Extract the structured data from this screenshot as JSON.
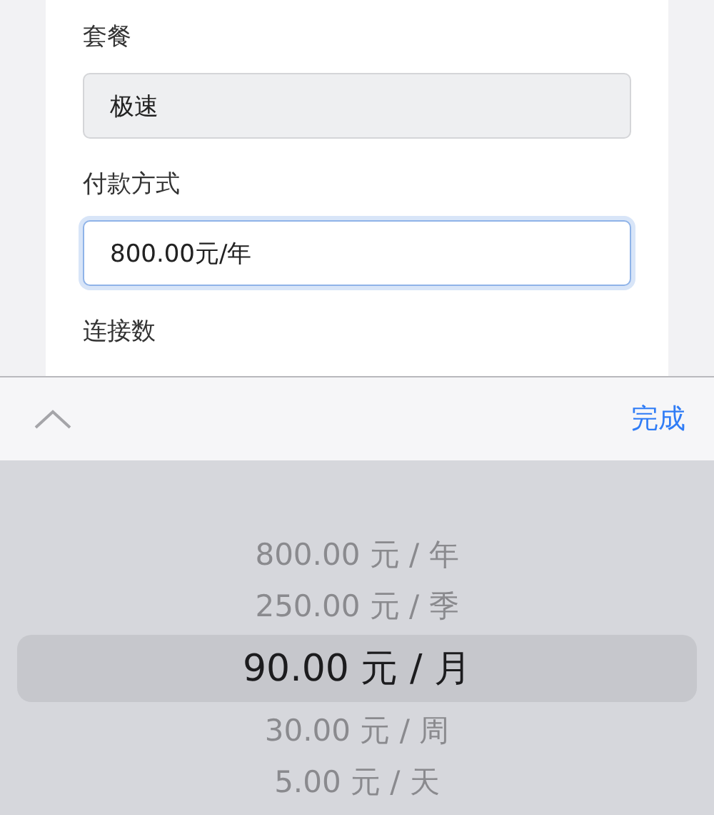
{
  "form": {
    "fields": [
      {
        "label": "套餐",
        "value": "极速",
        "disabled": true,
        "focused": false
      },
      {
        "label": "付款方式",
        "value": "800.00元/年",
        "disabled": false,
        "focused": true
      }
    ],
    "next_label": "连接数"
  },
  "toolbar": {
    "done": "完成"
  },
  "picker": {
    "options": [
      {
        "label": "800.00 元 / 年",
        "selected": false
      },
      {
        "label": "250.00 元 / 季",
        "selected": false
      },
      {
        "label": "90.00 元 / 月",
        "selected": true
      },
      {
        "label": "30.00 元 / 周",
        "selected": false
      },
      {
        "label": "5.00 元 / 天",
        "selected": false
      }
    ]
  }
}
